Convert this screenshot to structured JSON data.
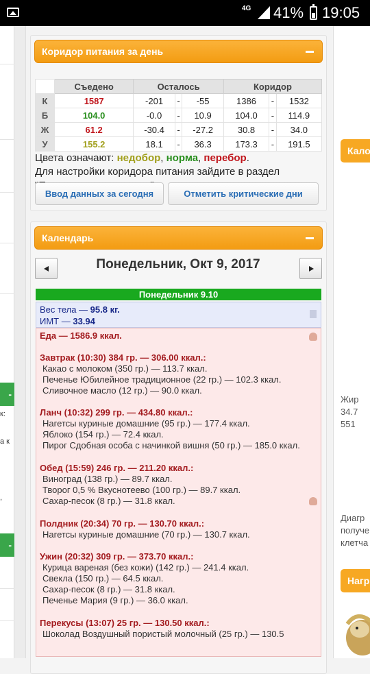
{
  "statusbar": {
    "network": "4G",
    "battery": "41%",
    "time": "19:05"
  },
  "left_strip": {
    "texts": [
      "к:",
      "а к",
      ","
    ],
    "tabs": [
      "-",
      "-"
    ]
  },
  "right_col": {
    "box1": "Кало",
    "box2": "Нагр",
    "texts": [
      "Жир",
      "34.7",
      "551",
      "Диагр",
      "получе",
      "клетча"
    ]
  },
  "corridor": {
    "title": "Коридор питания за день",
    "headers": [
      "Съедено",
      "Осталось",
      "Коридор"
    ],
    "rows": [
      {
        "label": "К",
        "eaten": "1587",
        "left_min": "-201",
        "left_max": "-55",
        "corr_min": "1386",
        "corr_max": "1532",
        "color": "#c0151b"
      },
      {
        "label": "Б",
        "eaten": "104.0",
        "left_min": "-0.0",
        "left_max": "10.9",
        "corr_min": "104.0",
        "corr_max": "114.9",
        "color": "#2a8f1f"
      },
      {
        "label": "Ж",
        "eaten": "61.2",
        "left_min": "-30.4",
        "left_max": "-27.2",
        "corr_min": "30.8",
        "corr_max": "34.0",
        "color": "#c0151b"
      },
      {
        "label": "У",
        "eaten": "155.2",
        "left_min": "18.1",
        "left_max": "36.3",
        "corr_min": "173.3",
        "corr_max": "191.5",
        "color": "#a19f1c"
      }
    ],
    "legend_prefix": "Цвета означают: ",
    "legend_under": "недобор",
    "legend_norm": "норма",
    "legend_over": "перебор",
    "legend_note": "Для настройки коридора питания зайдите в раздел \"Планирование питания\".",
    "btn_enter": "Ввод данных за сегодня",
    "btn_critical": "Отметить критические дни"
  },
  "calendar": {
    "title": "Календарь",
    "date": "Понедельник, Окт 9, 2017",
    "day_label": "Понедельник 9.10",
    "weight": "Вес тела — ",
    "weight_val": "95.8 кг.",
    "bmi": "ИМТ — ",
    "bmi_val": "33.94",
    "food_total": "Еда — 1586.9 ккал.",
    "meals": [
      {
        "header": "Завтрак (10:30) 384 гр. — 306.00 ккал.:",
        "items": [
          "Какао с молоком (350 гр.) — 113.7 ккал.",
          "Печенье Юбилейное традиционное (22 гр.) — 102.3 ккал.",
          "Сливочное масло (12 гр.) — 90.0 ккал."
        ]
      },
      {
        "header": "Ланч (10:32) 299 гр. — 434.80 ккал.:",
        "items": [
          "Нагетсы куриные домашние (95 гр.) — 177.4 ккал.",
          "Яблоко (154 гр.) — 72.4 ккал.",
          "Пирог Сдобная особа с начинкой вишня (50 гр.) — 185.0 ккал."
        ]
      },
      {
        "header": "Обед (15:59) 246 гр. — 211.20 ккал.:",
        "items": [
          "Виноград (138 гр.) — 89.7 ккал.",
          "Творог 0,5 % Вкуснотеево (100 гр.) — 89.7 ккал.",
          "Сахар-песок (8 гр.) — 31.8 ккал."
        ]
      },
      {
        "header": "Полдник (20:34) 70 гр. — 130.70 ккал.:",
        "items": [
          "Нагетсы куриные домашние (70 гр.) — 130.7 ккал."
        ]
      },
      {
        "header": "Ужин (20:32) 309 гр. — 373.70 ккал.:",
        "items": [
          "Курица вареная (без кожи) (142 гр.) — 241.4 ккал.",
          "Свекла (150 гр.) — 64.5 ккал.",
          "Сахар-песок (8 гр.) — 31.8 ккал.",
          "Печенье Мария (9 гр.) — 36.0 ккал."
        ]
      },
      {
        "header": "Перекусы (13:07) 25 гр. — 130.50 ккал.:",
        "items": [
          "Шоколад Воздушный пористый молочный (25 гр.) — 130.5"
        ]
      }
    ]
  }
}
